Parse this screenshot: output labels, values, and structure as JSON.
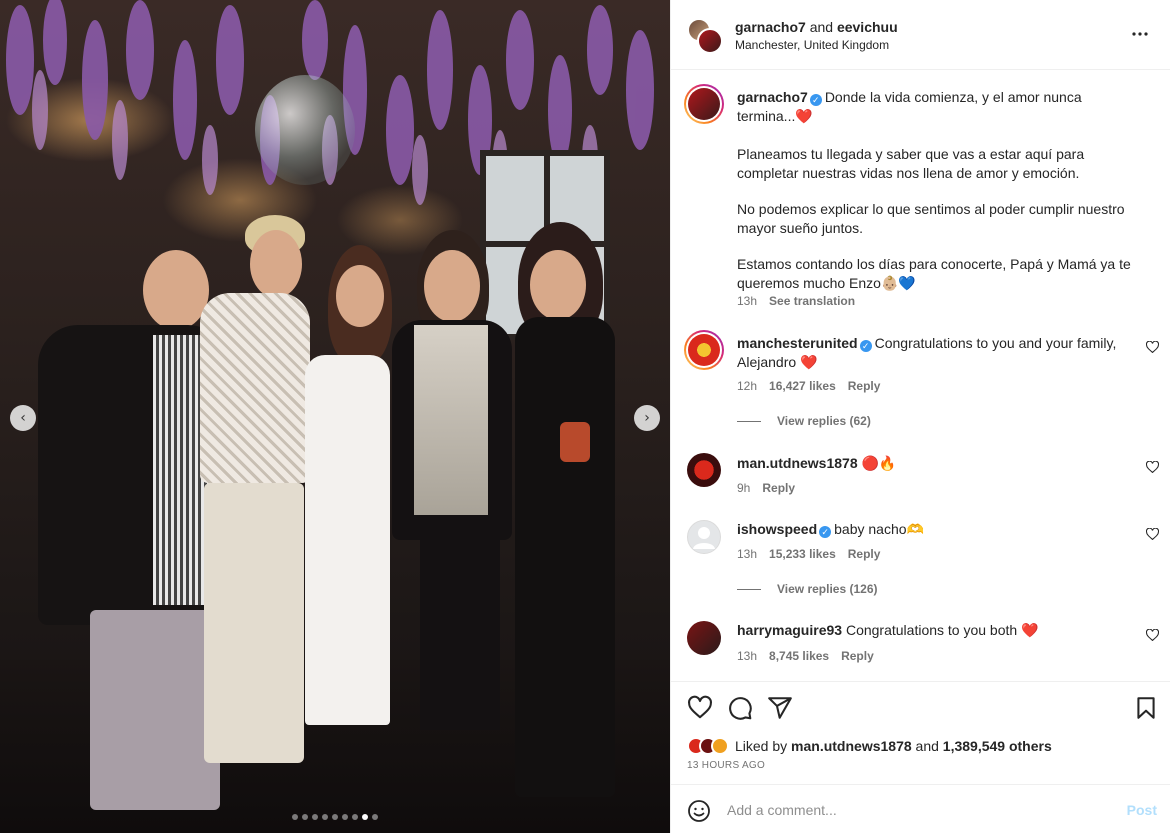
{
  "photo": {
    "prev_arrow": "‹",
    "next_arrow": "›",
    "carousel_total": 9,
    "carousel_active_index": 7
  },
  "header": {
    "user1": "garnacho7",
    "and_text": "and",
    "user2": "eevichuu",
    "location": "Manchester, United Kingdom",
    "more_icon": "more-horizontal-icon"
  },
  "caption": {
    "username": "garnacho7",
    "verified": true,
    "line1": "Donde la vida comienza, y el amor nunca termina...❤️",
    "para2": "Planeamos tu llegada y saber que vas a estar aquí para completar nuestras vidas nos llena de amor y emoción.",
    "para3": "No podemos explicar lo que sentimos al poder cumplir nuestro mayor sueño juntos.",
    "para4": "Estamos contando los días para conocerte, Papá y Mamá ya te queremos mucho Enzo👶🏼💙",
    "time": "13h",
    "see_translation": "See translation"
  },
  "comments": [
    {
      "username": "manchesterunited",
      "verified": true,
      "text": "Congratulations to you and your family, Alejandro ❤️",
      "time": "12h",
      "likes": "16,427 likes",
      "reply": "Reply",
      "view_replies": "View replies (62)"
    },
    {
      "username": "man.utdnews1878",
      "verified": false,
      "text": "🔴🔥",
      "time": "9h",
      "likes": "",
      "reply": "Reply",
      "view_replies": ""
    },
    {
      "username": "ishowspeed",
      "verified": true,
      "text": "baby nacho🫶",
      "time": "13h",
      "likes": "15,233 likes",
      "reply": "Reply",
      "view_replies": "View replies (126)"
    },
    {
      "username": "harrymaguire93",
      "verified": false,
      "text": "Congratulations to you both ❤️",
      "time": "13h",
      "likes": "8,745 likes",
      "reply": "Reply",
      "view_replies": ""
    }
  ],
  "actions": {
    "liked_by_prefix": "Liked by",
    "liked_by_user": "man.utdnews1878",
    "liked_and": "and",
    "liked_others": "1,389,549 others",
    "time_ago": "13 HOURS AGO"
  },
  "comment_box": {
    "placeholder": "Add a comment...",
    "post_label": "Post"
  },
  "colors": {
    "verified": "#3897f0",
    "heart_red": "#ed4956",
    "post_disabled": "#b2dffc",
    "secondary_text": "#737373"
  }
}
